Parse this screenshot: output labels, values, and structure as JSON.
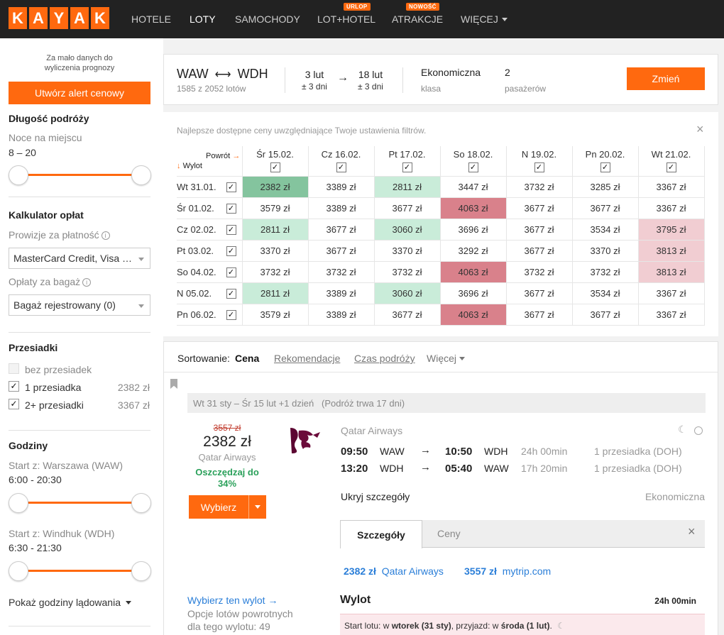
{
  "header": {
    "logo_letters": [
      "K",
      "A",
      "Y",
      "A",
      "K"
    ],
    "nav": [
      {
        "label": "HOTELE"
      },
      {
        "label": "LOTY"
      },
      {
        "label": "SAMOCHODY"
      },
      {
        "label": "LOT+HOTEL",
        "badge": "URLOP"
      },
      {
        "label": "ATRAKCJE",
        "badge": "NOWOŚĆ"
      },
      {
        "label": "WIĘCEJ"
      }
    ]
  },
  "sidebar": {
    "forecast_note_1": "Za mało danych do",
    "forecast_note_2": "wyliczenia prognozy",
    "alert_button": "Utwórz alert cenowy",
    "trip_length_title": "Długość podróży",
    "nights_label": "Noce na miejscu",
    "nights_value": "8 – 20",
    "fees_title": "Kalkulator opłat",
    "payment_fees_label": "Prowizje za płatność",
    "payment_select": "MasterCard Credit, Visa …",
    "baggage_fees_label": "Opłaty za bagaż",
    "baggage_select": "Bagaż rejestrowany (0)",
    "stops_title": "Przesiadki",
    "stops": [
      {
        "label": "bez przesiadek",
        "price": "",
        "checked": false,
        "disabled": true
      },
      {
        "label": "1 przesiadka",
        "price": "2382 zł",
        "checked": true,
        "disabled": false
      },
      {
        "label": "2+ przesiadki",
        "price": "3367 zł",
        "checked": true,
        "disabled": false
      }
    ],
    "hours_title": "Godziny",
    "start_waw_label": "Start z: Warszawa (WAW)",
    "start_waw_value": "6:00 - 20:30",
    "start_wdh_label": "Start z: Windhuk (WDH)",
    "start_wdh_value": "6:30 - 21:30",
    "landing_toggle": "Pokaż godziny lądowania"
  },
  "search": {
    "from": "WAW",
    "to": "WDH",
    "results_count": "1585 z 2052 lotów",
    "depart_date": "3 lut",
    "depart_flex": "± 3 dni",
    "return_date": "18 lut",
    "return_flex": "± 3 dni",
    "cabin": "Ekonomiczna",
    "cabin_label": "klasa",
    "passengers": "2",
    "passengers_label": "pasażerów",
    "change_button": "Zmień"
  },
  "matrix": {
    "note": "Najlepsze dostępne ceny uwzględniające Twoje ustawienia filtrów.",
    "return_label": "Powrót",
    "depart_label": "Wylot",
    "columns": [
      "Śr 15.02.",
      "Cz 16.02.",
      "Pt 17.02.",
      "So 18.02.",
      "N 19.02.",
      "Pn 20.02.",
      "Wt 21.02."
    ],
    "rows": [
      {
        "label": "Wt 31.01.",
        "cells": [
          "2382 zł",
          "3389 zł",
          "2811 zł",
          "3447 zł",
          "3732 zł",
          "3285 zł",
          "3367 zł"
        ],
        "shade": [
          "g1",
          "",
          "g2",
          "",
          "",
          "",
          ""
        ]
      },
      {
        "label": "Śr 01.02.",
        "cells": [
          "3579 zł",
          "3389 zł",
          "3677 zł",
          "4063 zł",
          "3677 zł",
          "3677 zł",
          "3367 zł"
        ],
        "shade": [
          "",
          "",
          "",
          "r1",
          "",
          "",
          ""
        ]
      },
      {
        "label": "Cz 02.02.",
        "cells": [
          "2811 zł",
          "3677 zł",
          "3060 zł",
          "3696 zł",
          "3677 zł",
          "3534 zł",
          "3795 zł"
        ],
        "shade": [
          "g2",
          "",
          "g2",
          "",
          "",
          "",
          "r2"
        ]
      },
      {
        "label": "Pt 03.02.",
        "cells": [
          "3370 zł",
          "3677 zł",
          "3370 zł",
          "3292 zł",
          "3677 zł",
          "3370 zł",
          "3813 zł"
        ],
        "shade": [
          "",
          "",
          "",
          "",
          "",
          "",
          "r2"
        ]
      },
      {
        "label": "So 04.02.",
        "cells": [
          "3732 zł",
          "3732 zł",
          "3732 zł",
          "4063 zł",
          "3732 zł",
          "3732 zł",
          "3813 zł"
        ],
        "shade": [
          "",
          "",
          "",
          "r1",
          "",
          "",
          "r2"
        ]
      },
      {
        "label": "N 05.02.",
        "cells": [
          "2811 zł",
          "3389 zł",
          "3060 zł",
          "3696 zł",
          "3677 zł",
          "3534 zł",
          "3367 zł"
        ],
        "shade": [
          "g2",
          "",
          "g2",
          "",
          "",
          "",
          ""
        ]
      },
      {
        "label": "Pn 06.02.",
        "cells": [
          "3579 zł",
          "3389 zł",
          "3677 zł",
          "4063 zł",
          "3677 zł",
          "3677 zł",
          "3367 zł"
        ],
        "shade": [
          "",
          "",
          "",
          "r1",
          "",
          "",
          ""
        ]
      }
    ]
  },
  "sorting": {
    "label": "Sortowanie:",
    "active": "Cena",
    "options": [
      "Rekomendacje",
      "Czas podróży",
      "Więcej"
    ]
  },
  "result": {
    "trip_summary": "Wt 31 sty – Śr 15 lut +1 dzień",
    "trip_duration": "(Podróż trwa 17 dni)",
    "old_price": "3557 zł",
    "price": "2382 zł",
    "airline_small": "Qatar Airways",
    "savings": "Oszczędzaj do 34%",
    "select_button": "Wybierz",
    "airline": "Qatar Airways",
    "legs": [
      {
        "dep_time": "09:50",
        "dep": "WAW",
        "arr_time": "10:50",
        "arr": "WDH",
        "duration": "24h 00min",
        "stops": "1 przesiadka (DOH)"
      },
      {
        "dep_time": "13:20",
        "dep": "WDH",
        "arr_time": "05:40",
        "arr": "WAW",
        "duration": "17h 20min",
        "stops": "1 przesiadka (DOH)"
      }
    ],
    "hide_details": "Ukryj szczegóły",
    "cabin": "Ekonomiczna",
    "tab_details": "Szczegóły",
    "tab_prices": "Ceny",
    "providers": [
      {
        "price": "2382 zł",
        "name": "Qatar Airways"
      },
      {
        "price": "3557 zł",
        "name": "mytrip.com"
      }
    ],
    "choose_flight_link": "Wybierz ten wylot",
    "return_options_1": "Opcje lotów powrotnych",
    "return_options_2": "dla tego wylotu: 49",
    "departure_title": "Wylot",
    "departure_duration": "24h 00min",
    "notice_prefix": "Start lotu: w ",
    "notice_day1": "wtorek (31 sty)",
    "notice_mid": ", przyjazd: w ",
    "notice_day2": "środa (1 lut)",
    "notice_end": "."
  }
}
